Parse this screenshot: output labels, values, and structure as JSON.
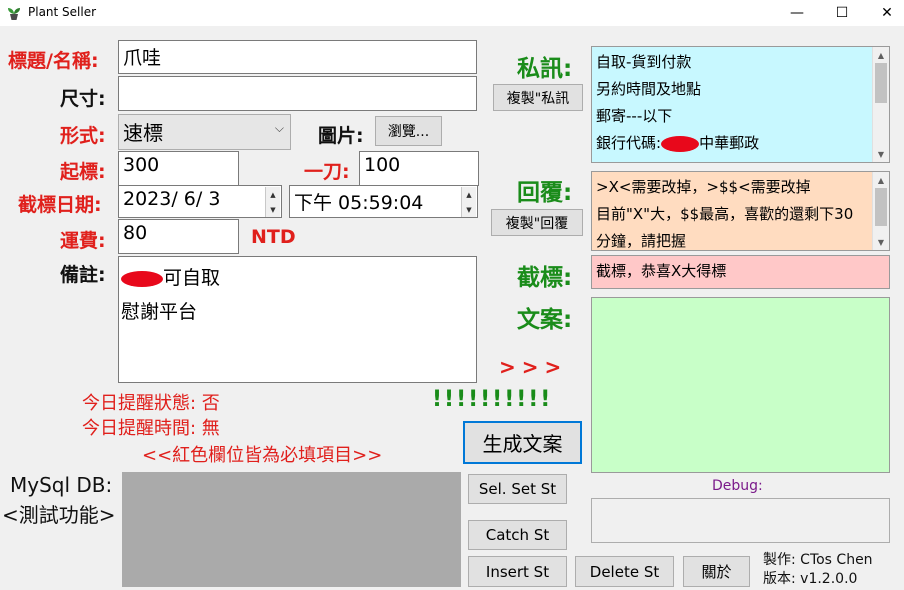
{
  "window": {
    "title": "Plant Seller",
    "minimize": "—",
    "maximize": "☐",
    "close": "✕"
  },
  "labels": {
    "title": "標題/名稱:",
    "size": "尺寸:",
    "format": "形式:",
    "picture": "圖片:",
    "start_price": "起標:",
    "one_knife": "一刀:",
    "end_date": "截標日期:",
    "shipping": "運費:",
    "currency": "NTD",
    "note": "備註:",
    "private_msg": "私訊:",
    "reply": "回覆:",
    "close_bid": "截標:",
    "copywriting": "文案:",
    "arrows": ">>>",
    "exclaims": "!!!!!!!!!!",
    "reminder_status": "今日提醒狀態: 否",
    "reminder_time": "今日提醒時間: 無",
    "required_note": "<<紅色欄位皆為必填項目>>",
    "mysql": "MySql DB:",
    "test_func": "<測試功能>",
    "debug": "Debug:",
    "author": "製作: CTos Chen",
    "version": "版本: v1.2.0.0"
  },
  "fields": {
    "title": "爪哇",
    "size": "",
    "format": "速標",
    "start_price": "300",
    "one_knife": "100",
    "date": "2023/  6/  3",
    "time": "下午 05:59:04",
    "shipping": "80",
    "note_line1": "可自取",
    "note_line2": "慰謝平台"
  },
  "buttons": {
    "browse": "瀏覽...",
    "copy_private": "複製\"私訊",
    "copy_reply": "複製\"回覆",
    "generate": "生成文案",
    "sel_set": "Sel. Set St",
    "catch": "Catch St",
    "insert": "Insert St",
    "delete": "Delete St",
    "about": "關於"
  },
  "panels": {
    "private_lines": [
      "自取-貨到付款",
      "另約時間及地點",
      "郵寄---以下",
      "中華郵政"
    ],
    "private_line4_prefix": "銀行代碼:",
    "reply_lines": [
      ">X<需要改掉，>$$<需要改掉",
      "目前\"X\"大，$$最高，喜歡的還剩下30",
      "分鐘，請把握"
    ],
    "close_text": "截標，恭喜X大得標"
  },
  "colors": {
    "required_red": "#e0201c",
    "green_label": "#1a8c1a",
    "private_bg": "#c8f8ff",
    "reply_bg": "#ffdcc0",
    "close_bg": "#ffc8c8",
    "copy_bg": "#c8ffc8",
    "db_box_bg": "#aaaaaa"
  }
}
